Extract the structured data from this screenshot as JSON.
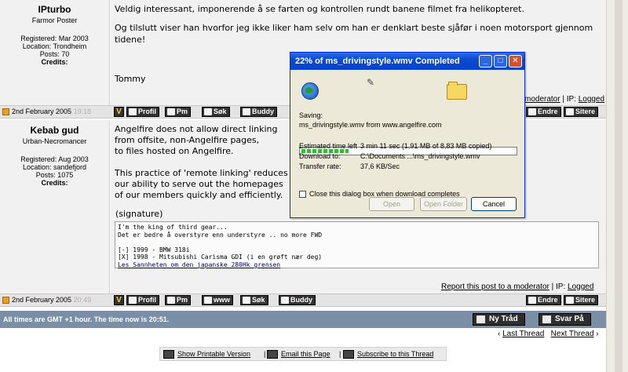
{
  "post1": {
    "username": "IPturbo",
    "user_title": "Farmor Poster",
    "registered": "Registered: Mar 2003",
    "location": "Location: Trondheim",
    "posts": "Posts: 70",
    "credits": "Credits:",
    "line1": "Veldig interessant, imponerende å se farten og kontrollen rundt banene filmet fra helikopteret.",
    "line2": "Og tilslutt viser han hvorfor jeg ikke liker ham selv om han er denklart beste sjåfør i noen motorsport gjennom",
    "line3": "tidene!",
    "signoff": "Tommy",
    "report_text": "moderator",
    "ip_label": "| IP:",
    "ip_link": "Logged",
    "date": "2nd February 2005",
    "time": "19:18"
  },
  "post2": {
    "username": "Kebab gud",
    "user_title": "Urban-Necromancer",
    "registered": "Registered: Aug 2003",
    "location": "Location: sandefjord",
    "posts": "Posts: 1075",
    "credits": "Credits:",
    "lines": [
      "Angelfire does not allow direct linking",
      "from offsite, non-Angelfire pages,",
      "to files hosted on Angelfire.",
      "",
      "This practice of 'remote linking' reduces",
      "our ability to serve out the homepages",
      "of our members quickly and efficiently."
    ],
    "signature_label": "(signature)",
    "sig_lines": [
      "I'm the king of third gear...",
      "Det er bedre å overstyre enn understyre .. no more FWD",
      "",
      "[-] 1999 - BMW 318i",
      "[X] 1998 - Mitsubishi Carisma GDI (i en grøft nær deg)"
    ],
    "sig_link": "Les Sannheten om den japanske 280Hk grensen",
    "report_text": "Report this post to a moderator",
    "ip_label": "| IP:",
    "ip_link": "Logged",
    "date": "2nd February 2005",
    "time": "20:49"
  },
  "post_buttons": {
    "profil": "Profil",
    "pm": "Pm",
    "sok": "Søk",
    "buddy": "Buddy",
    "www": "www",
    "endre": "Endre",
    "sitere": "Sitere",
    "v": "V"
  },
  "footer": {
    "time_text": "All times are GMT +1 hour. The time now is 20:51.",
    "new_thread": "Ny Tråd",
    "reply": "Svar På",
    "last_thread": "Last Thread",
    "next_thread": "Next Thread",
    "printable": "Show Printable Version",
    "email": "Email this Page",
    "subscribe": "Subscribe to this Thread",
    "sep": "|"
  },
  "dialog": {
    "title": "22% of ms_drivingstyle.wmv Completed",
    "saving_label": "Saving:",
    "saving_value": "ms_drivingstyle.wmv from www.angelfire.com",
    "progress_fraction": 0.22,
    "time_left_label": "Estimated time left",
    "time_left_value": "3 min 11 sec (1,91 MB of 8,83 MB copied)",
    "download_to_label": "Download to:",
    "download_to_value": "C:\\Documents ...\\ms_drivingstyle.wmv",
    "rate_label": "Transfer rate:",
    "rate_value": "37,6 KB/Sec",
    "close_checkbox": "Close this dialog box when download completes",
    "open": "Open",
    "open_folder": "Open Folder",
    "cancel": "Cancel"
  }
}
